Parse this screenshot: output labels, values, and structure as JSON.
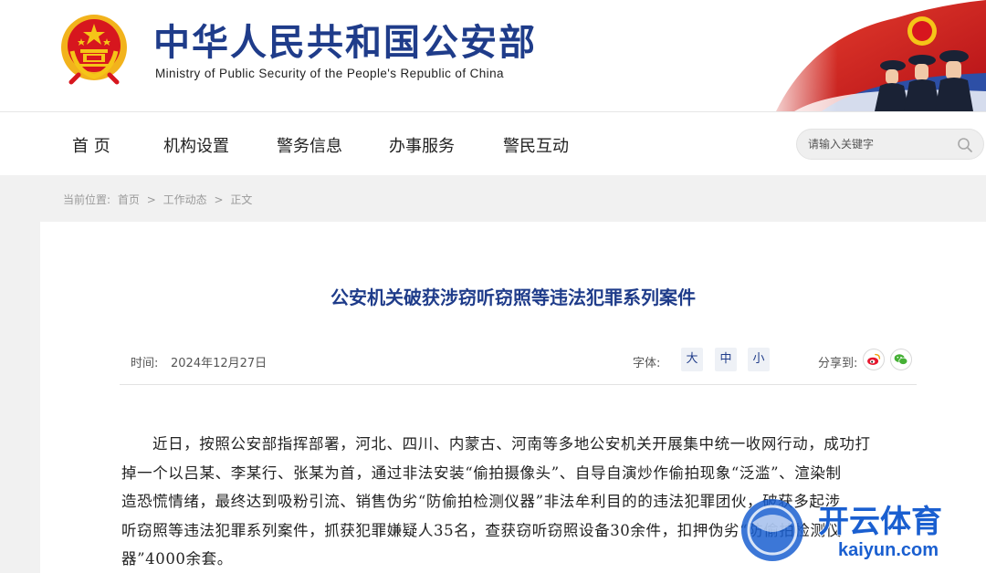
{
  "header": {
    "title": "中华人民共和国公安部",
    "subtitle": "Ministry of Public Security of the People's Republic of China"
  },
  "nav": {
    "items": [
      {
        "label": "首 页"
      },
      {
        "label": "机构设置"
      },
      {
        "label": "警务信息"
      },
      {
        "label": "办事服务"
      },
      {
        "label": "警民互动"
      }
    ],
    "search_placeholder": "请输入关键字"
  },
  "breadcrumb": {
    "prefix": "当前位置:",
    "items": [
      "首页",
      "工作动态",
      "正文"
    ],
    "separator": ">"
  },
  "article": {
    "title": "公安机关破获涉窃听窃照等违法犯罪系列案件",
    "time_label": "时间:",
    "time": "2024年12月27日",
    "font_label": "字体:",
    "font_sizes": [
      "大",
      "中",
      "小"
    ],
    "share_label": "分享到:",
    "share_icons": [
      "weibo-icon",
      "wechat-icon"
    ],
    "body_lines": [
      "近日，按照公安部指挥部署，河北、四川、内蒙古、河南等多地公安机关开展集中统一收网行动，成功打",
      "掉一个以吕某、李某行、张某为首，通过非法安装“偷拍摄像头”、自导自演炒作偷拍现象“泛滥”、渲染制",
      "造恐慌情绪，最终达到吸粉引流、销售伪劣“防偷拍检测仪器”非法牟利目的的违法犯罪团伙，破获多起涉",
      "听窃照等违法犯罪系列案件，抓获犯罪嫌疑人35名，查获窃听窃照设备30余件，扣押伪劣“防偷拍检测仪",
      "器”4000余套。"
    ]
  },
  "watermark": {
    "brand": "开云体育",
    "domain": "kaiyun.com"
  },
  "colors": {
    "brand_blue": "#1f3c8a",
    "emblem_red": "#d7161e",
    "emblem_gold": "#f5c518"
  }
}
